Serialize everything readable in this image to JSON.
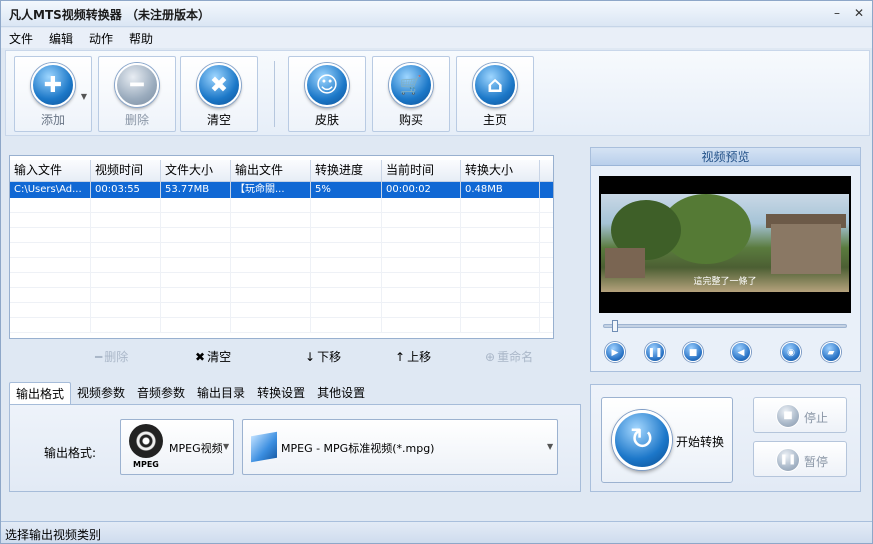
{
  "window": {
    "title": "凡人MTS视频转换器 （未注册版本）",
    "minimize": "–",
    "close": "✕"
  },
  "menu": [
    "文件",
    "编辑",
    "动作",
    "帮助"
  ],
  "toolbar": {
    "add_label": "添加",
    "delete_label": "删除",
    "clear_label": "清空",
    "skin_label": "皮肤",
    "buy_label": "购买",
    "home_label": "主页"
  },
  "file_list": {
    "columns": [
      "输入文件",
      "视频时间",
      "文件大小",
      "输出文件",
      "转换进度",
      "当前时间",
      "转换大小"
    ],
    "rows": [
      [
        "C:\\Users\\Ad...",
        "00:03:55",
        "53.77MB",
        "【玩命關...",
        "5%",
        "00:00:02",
        "0.48MB"
      ]
    ]
  },
  "list_actions": {
    "delete": "删除",
    "clear": "清空",
    "move_down": "下移",
    "move_up": "上移",
    "rename": "重命名"
  },
  "preview": {
    "title": "视频预览",
    "subtitle": "這完整了一條了"
  },
  "tabs": [
    "输出格式",
    "视频参数",
    "音频参数",
    "输出目录",
    "转换设置",
    "其他设置"
  ],
  "output_format": {
    "label": "输出格式:",
    "category": "MPEG视频",
    "category_icon_text": "MPEG",
    "format": "MPEG - MPG标准视频(*.mpg)"
  },
  "convert": {
    "start": "开始转换",
    "stop": "停止",
    "pause": "暂停"
  },
  "status": {
    "text": "选择输出视频类别"
  },
  "colors": {
    "selection": "#1068d4",
    "accent_blue": "#1c78c8"
  }
}
